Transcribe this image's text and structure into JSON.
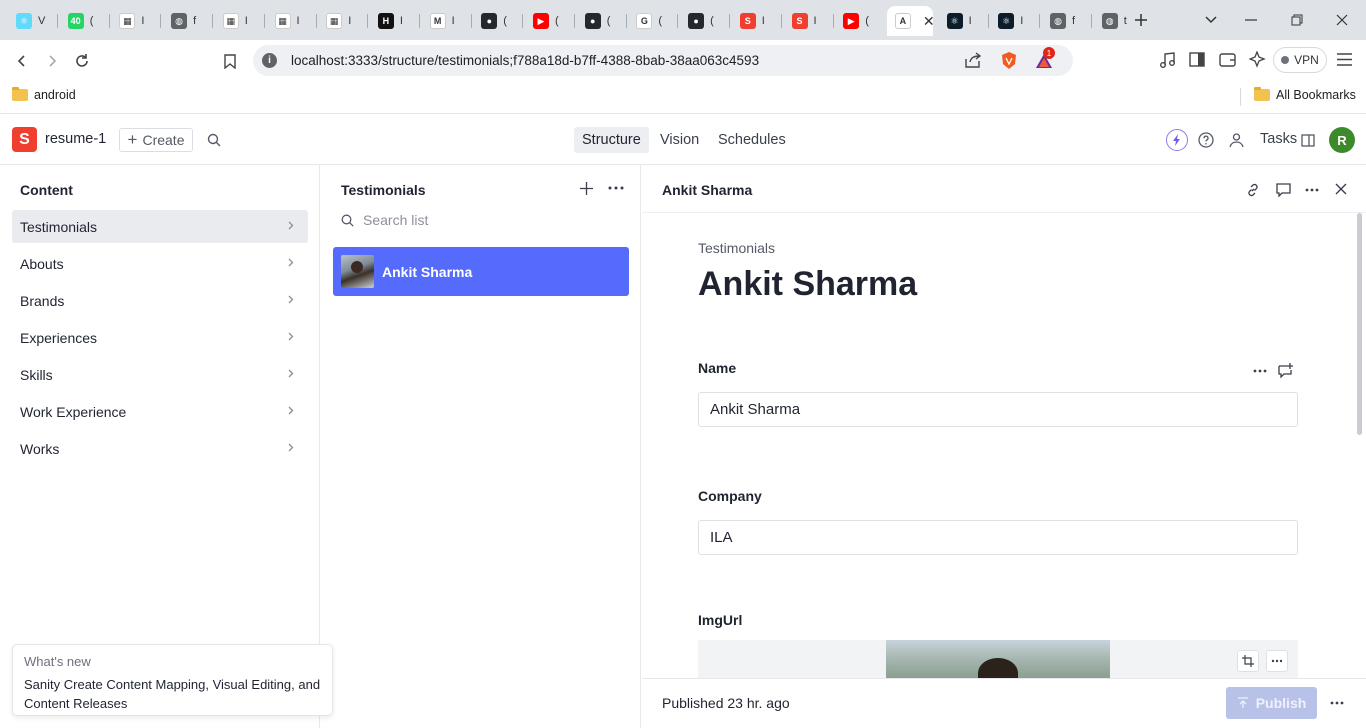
{
  "browser": {
    "tabs": [
      {
        "icon": "react-icon",
        "color": "#61dafb",
        "glyph": "⚛",
        "title": "V"
      },
      {
        "icon": "whatsapp-icon",
        "color": "#25d366",
        "glyph": "40",
        "title": "("
      },
      {
        "icon": "ncert-icon",
        "color": "#ffffff",
        "glyph": "▦",
        "title": "I"
      },
      {
        "icon": "globe-icon",
        "color": "#5f6368",
        "glyph": "◍",
        "title": "f"
      },
      {
        "icon": "ncert-icon",
        "color": "#ffffff",
        "glyph": "▦",
        "title": "I"
      },
      {
        "icon": "ncert-icon",
        "color": "#ffffff",
        "glyph": "▦",
        "title": "I"
      },
      {
        "icon": "ncert-icon",
        "color": "#ffffff",
        "glyph": "▦",
        "title": "I"
      },
      {
        "icon": "hackerrank-icon",
        "color": "#111111",
        "glyph": "H",
        "title": "I"
      },
      {
        "icon": "gmail-icon",
        "color": "#ffffff",
        "glyph": "M",
        "title": "I"
      },
      {
        "icon": "github-icon",
        "color": "#24292f",
        "glyph": "●",
        "title": "("
      },
      {
        "icon": "youtube-icon",
        "color": "#ff0000",
        "glyph": "▶",
        "title": "("
      },
      {
        "icon": "github-icon",
        "color": "#24292f",
        "glyph": "●",
        "title": "("
      },
      {
        "icon": "google-icon",
        "color": "#ffffff",
        "glyph": "G",
        "title": "("
      },
      {
        "icon": "github-icon",
        "color": "#24292f",
        "glyph": "●",
        "title": "("
      },
      {
        "icon": "sanity-icon",
        "color": "#f03e2f",
        "glyph": "S",
        "title": "I"
      },
      {
        "icon": "sanity-icon",
        "color": "#f03e2f",
        "glyph": "S",
        "title": "I"
      },
      {
        "icon": "youtube-icon",
        "color": "#ff0000",
        "glyph": "▶",
        "title": "("
      },
      {
        "icon": "sanity-active-icon",
        "color": "#ffffff",
        "glyph": "A",
        "title": ""
      },
      {
        "icon": "react-icon",
        "color": "#0b1d2a",
        "glyph": "⚛",
        "title": "I"
      },
      {
        "icon": "react-icon",
        "color": "#0b1d2a",
        "glyph": "⚛",
        "title": "I"
      },
      {
        "icon": "globe-icon",
        "color": "#5f6368",
        "glyph": "◍",
        "title": "f"
      },
      {
        "icon": "globe-icon",
        "color": "#5f6368",
        "glyph": "◍",
        "title": "t"
      }
    ],
    "url": "localhost:3333/structure/testimonials;f788a18d-b7ff-4388-8bab-38aa063c4593",
    "vpn_label": "VPN",
    "brave_badge": "1",
    "bookmarks": {
      "folder": "android",
      "all": "All Bookmarks"
    }
  },
  "studio": {
    "logo_letter": "S",
    "project": "resume-1",
    "create_label": "Create",
    "nav": [
      "Structure",
      "Vision",
      "Schedules"
    ],
    "tasks_label": "Tasks",
    "avatar_letter": "R"
  },
  "content_pane": {
    "title": "Content",
    "items": [
      "Testimonials",
      "Abouts",
      "Brands",
      "Experiences",
      "Skills",
      "Work Experience",
      "Works"
    ]
  },
  "whats_new": {
    "heading": "What's new",
    "body": "Sanity Create Content Mapping, Visual Editing, and Content Releases"
  },
  "list_pane": {
    "title": "Testimonials",
    "search_placeholder": "Search list",
    "items": [
      {
        "title": "Ankit Sharma"
      }
    ]
  },
  "document": {
    "header_title": "Ankit Sharma",
    "type_label": "Testimonials",
    "title": "Ankit Sharma",
    "fields": {
      "name": {
        "label": "Name",
        "value": "Ankit Sharma"
      },
      "company": {
        "label": "Company",
        "value": "ILA"
      },
      "imgurl": {
        "label": "ImgUrl"
      }
    },
    "status": "Published 23 hr. ago",
    "publish_label": "Publish"
  },
  "colors": {
    "accent": "#556bfc",
    "brand": "#f03e2f",
    "avatar": "#3d8a2b"
  }
}
